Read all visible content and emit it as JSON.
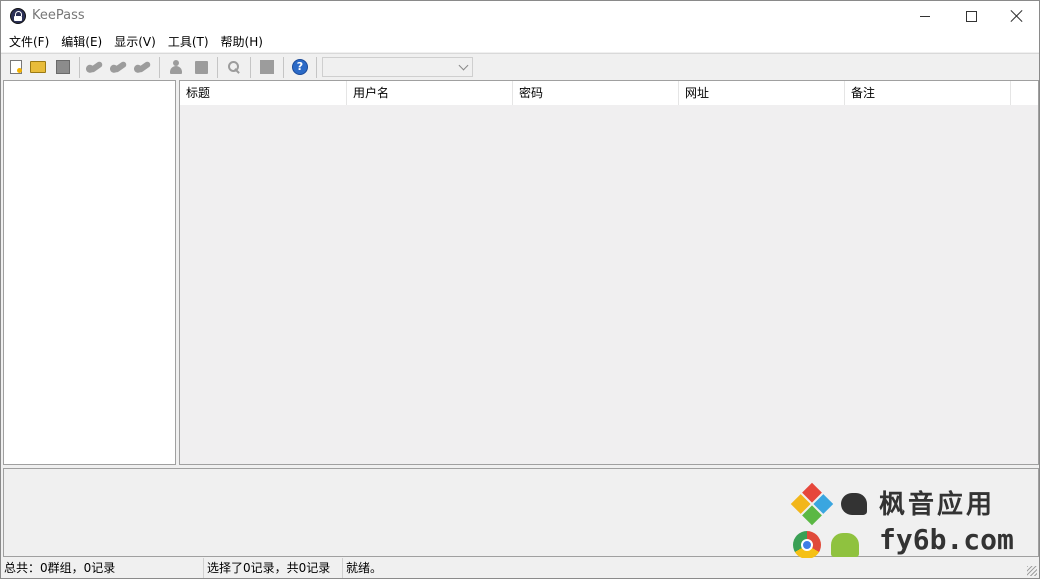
{
  "window": {
    "title": "KeePass"
  },
  "menu": [
    {
      "label": "文件(F)"
    },
    {
      "label": "编辑(E)"
    },
    {
      "label": "显示(V)"
    },
    {
      "label": "工具(T)"
    },
    {
      "label": "帮助(H)"
    }
  ],
  "toolbar": {
    "icons": [
      "new-database-icon",
      "open-folder-icon",
      "save-disk-icon",
      "add-entry-key-icon",
      "edit-entry-key-icon",
      "delete-entry-key-icon",
      "copy-username-icon",
      "copy-password-icon",
      "find-icon",
      "lock-workspace-icon",
      "help-icon"
    ],
    "help_glyph": "?",
    "quick_find": {
      "value": ""
    }
  },
  "entry_list": {
    "columns": [
      {
        "label": "标题"
      },
      {
        "label": "用户名"
      },
      {
        "label": "密码"
      },
      {
        "label": "网址"
      },
      {
        "label": "备注"
      }
    ],
    "rows": []
  },
  "group_tree": {
    "items": []
  },
  "status": {
    "totals": "总共：0群组，0记录",
    "selection": "选择了0记录，共0记录",
    "state": "就绪。"
  },
  "watermark": {
    "chinese": "枫音应用",
    "domain": "fy6b.com"
  },
  "colors": {
    "window_bg": "#f0f0f0",
    "list_bg": "#f0eff0",
    "help_blue": "#2b6ac7"
  }
}
